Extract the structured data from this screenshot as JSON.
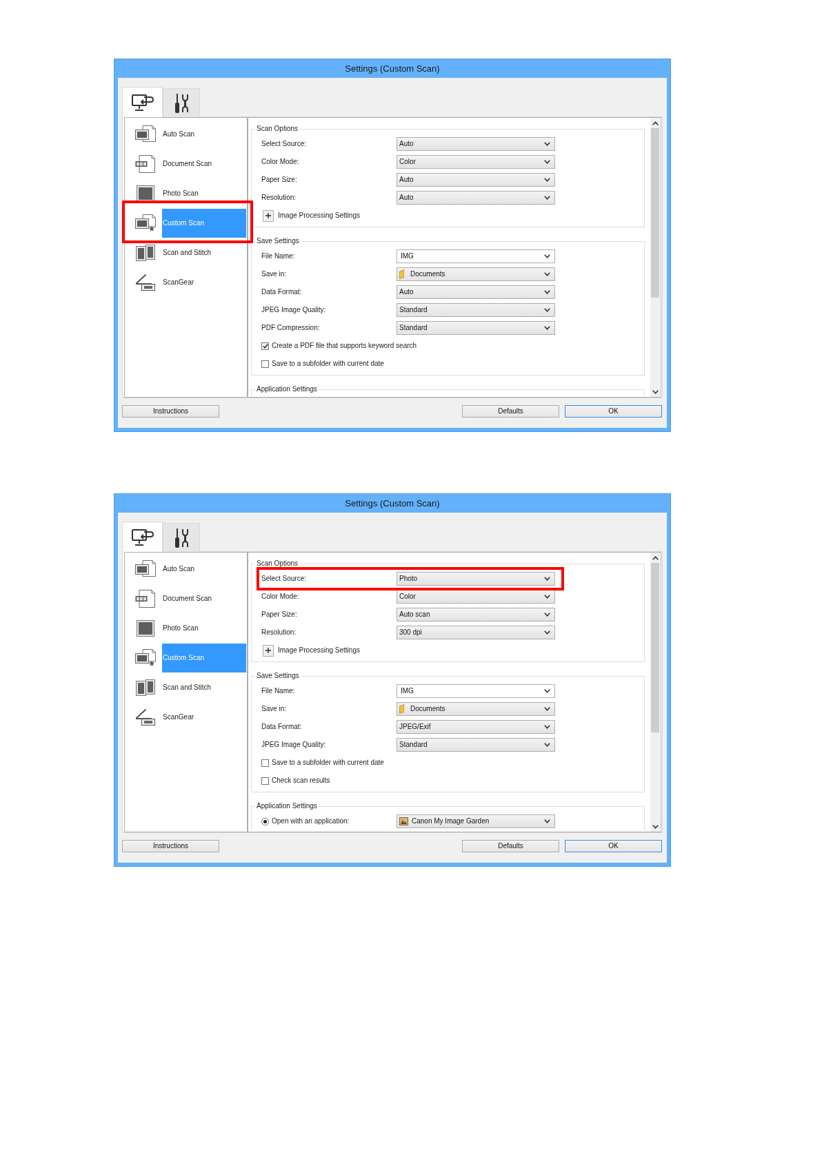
{
  "windows": [
    {
      "title": "Settings (Custom Scan)",
      "tabs": [
        {
          "selected": true
        },
        {
          "selected": false
        }
      ],
      "sidebar": {
        "items": [
          {
            "label": "Auto Scan",
            "selected": false,
            "highlighted": false
          },
          {
            "label": "Document Scan",
            "selected": false,
            "highlighted": false
          },
          {
            "label": "Photo Scan",
            "selected": false,
            "highlighted": false
          },
          {
            "label": "Custom Scan",
            "selected": true,
            "highlighted": true
          },
          {
            "label": "Scan and Stitch",
            "selected": false,
            "highlighted": false
          },
          {
            "label": "ScanGear",
            "selected": false,
            "highlighted": false
          }
        ]
      },
      "groups": [
        {
          "title": "Scan Options",
          "rows": [
            {
              "kind": "select",
              "label": "Select Source:",
              "value": "Auto",
              "highlighted": false
            },
            {
              "kind": "select",
              "label": "Color Mode:",
              "value": "Color",
              "highlighted": false
            },
            {
              "kind": "select",
              "label": "Paper Size:",
              "value": "Auto",
              "highlighted": false
            },
            {
              "kind": "select",
              "label": "Resolution:",
              "value": "Auto",
              "highlighted": false
            },
            {
              "kind": "expander",
              "label": "Image Processing Settings",
              "expanded": false,
              "highlighted": false
            }
          ]
        },
        {
          "title": "Save Settings",
          "rows": [
            {
              "kind": "combo",
              "label": "File Name:",
              "value": "IMG",
              "highlighted": false
            },
            {
              "kind": "folder",
              "label": "Save in:",
              "value": "Documents",
              "highlighted": false
            },
            {
              "kind": "select",
              "label": "Data Format:",
              "value": "Auto",
              "highlighted": false
            },
            {
              "kind": "select",
              "label": "JPEG Image Quality:",
              "value": "Standard",
              "highlighted": false
            },
            {
              "kind": "select",
              "label": "PDF Compression:",
              "value": "Standard",
              "highlighted": false
            },
            {
              "kind": "checkbox",
              "label": "Create a PDF file that supports keyword search",
              "checked": true,
              "highlighted": false
            },
            {
              "kind": "checkbox",
              "label": "Save to a subfolder with current date",
              "checked": false,
              "highlighted": false
            }
          ]
        },
        {
          "title": "Application Settings"
        }
      ],
      "buttons": [
        {
          "label": "Instructions",
          "default": false
        },
        {
          "label": "Defaults",
          "default": false
        },
        {
          "label": "OK",
          "default": true
        }
      ]
    },
    {
      "title": "Settings (Custom Scan)",
      "tabs": [
        {
          "selected": true
        },
        {
          "selected": false
        }
      ],
      "sidebar": {
        "items": [
          {
            "label": "Auto Scan",
            "selected": false,
            "highlighted": false
          },
          {
            "label": "Document Scan",
            "selected": false,
            "highlighted": false
          },
          {
            "label": "Photo Scan",
            "selected": false,
            "highlighted": false
          },
          {
            "label": "Custom Scan",
            "selected": true,
            "highlighted": false
          },
          {
            "label": "Scan and Stitch",
            "selected": false,
            "highlighted": false
          },
          {
            "label": "ScanGear",
            "selected": false,
            "highlighted": false
          }
        ]
      },
      "groups": [
        {
          "title": "Scan Options",
          "rows": [
            {
              "kind": "select",
              "label": "Select Source:",
              "value": "Photo",
              "highlighted": true
            },
            {
              "kind": "select",
              "label": "Color Mode:",
              "value": "Color",
              "highlighted": false
            },
            {
              "kind": "select",
              "label": "Paper Size:",
              "value": "Auto scan",
              "highlighted": false
            },
            {
              "kind": "select",
              "label": "Resolution:",
              "value": "300 dpi",
              "highlighted": false
            },
            {
              "kind": "expander",
              "label": "Image Processing Settings",
              "expanded": false,
              "highlighted": false
            }
          ]
        },
        {
          "title": "Save Settings",
          "rows": [
            {
              "kind": "combo",
              "label": "File Name:",
              "value": "IMG",
              "highlighted": false
            },
            {
              "kind": "folder",
              "label": "Save in:",
              "value": "Documents",
              "highlighted": false
            },
            {
              "kind": "select",
              "label": "Data Format:",
              "value": "JPEG/Exif",
              "highlighted": false
            },
            {
              "kind": "select",
              "label": "JPEG Image Quality:",
              "value": "Standard",
              "highlighted": false
            },
            {
              "kind": "checkbox",
              "label": "Save to a subfolder with current date",
              "checked": false,
              "highlighted": false
            },
            {
              "kind": "checkbox",
              "label": "Check scan results",
              "checked": false,
              "highlighted": false
            }
          ]
        },
        {
          "title": "Application Settings",
          "rows": [
            {
              "kind": "radio",
              "label": "Open with an application:",
              "selected": true,
              "value": "Canon My Image Garden",
              "highlighted": false
            }
          ]
        }
      ],
      "buttons": [
        {
          "label": "Instructions",
          "default": false
        },
        {
          "label": "Defaults",
          "default": false
        },
        {
          "label": "OK",
          "default": true
        }
      ]
    }
  ]
}
